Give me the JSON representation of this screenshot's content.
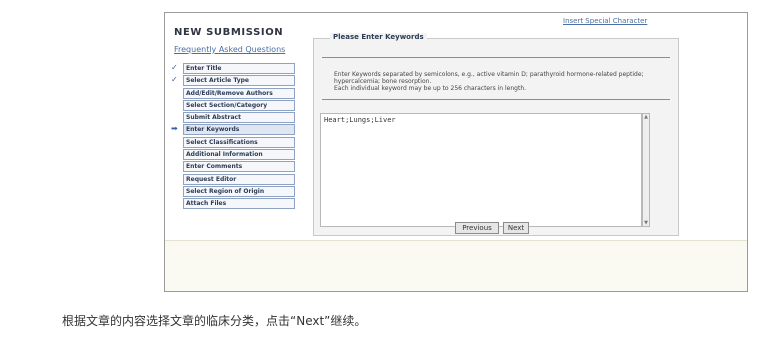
{
  "form": {
    "insert_link": "Insert Special Character",
    "title": "NEW SUBMISSION",
    "faq_link": "Frequently Asked Questions",
    "steps": [
      {
        "label": "Enter Title",
        "mark": "✓"
      },
      {
        "label": "Select Article Type",
        "mark": "✓"
      },
      {
        "label": "Add/Edit/Remove Authors",
        "mark": ""
      },
      {
        "label": "Select Section/Category",
        "mark": ""
      },
      {
        "label": "Submit Abstract",
        "mark": ""
      },
      {
        "label": "Enter Keywords",
        "mark": "➡"
      },
      {
        "label": "Select Classifications",
        "mark": ""
      },
      {
        "label": "Additional Information",
        "mark": ""
      },
      {
        "label": "Enter Comments",
        "mark": ""
      },
      {
        "label": "Request Editor",
        "mark": ""
      },
      {
        "label": "Select Region of Origin",
        "mark": ""
      },
      {
        "label": "Attach Files",
        "mark": ""
      }
    ],
    "current_step": "Enter Keywords",
    "panel_title": "Please Enter Keywords",
    "instructions_1": "Enter Keywords separated by semicolons, e.g., active vitamin D; parathyroid hormone-related peptide; hypercalcemia; bone resorption.",
    "instructions_2": "Each individual keyword may be up to 256 characters in length.",
    "keywords_value": "Heart;Lungs;Liver",
    "previous_label": "Previous",
    "next_label": "Next"
  },
  "caption": "根据文章的内容选择文章的临床分类，点击“Next”继续。",
  "colors": {
    "accent": "#4a6fa0",
    "rule": "#e06a6a"
  },
  "icons": {
    "check": "check-icon",
    "current": "arrow-right-icon"
  }
}
